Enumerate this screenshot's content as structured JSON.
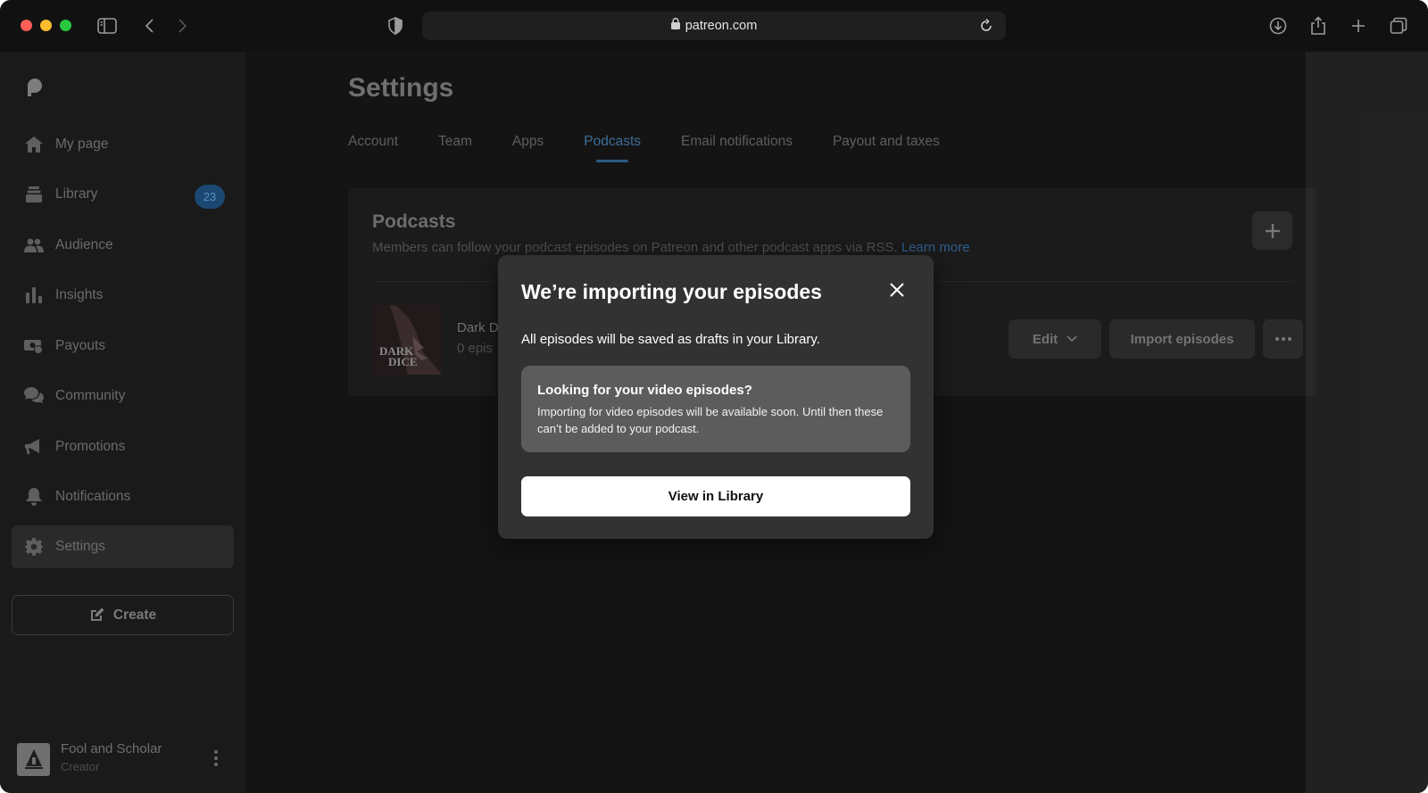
{
  "browser": {
    "url": "patreon.com"
  },
  "sidebar": {
    "items": [
      {
        "label": "My page",
        "icon": "home-icon"
      },
      {
        "label": "Library",
        "icon": "library-icon",
        "badge": "23"
      },
      {
        "label": "Audience",
        "icon": "audience-icon"
      },
      {
        "label": "Insights",
        "icon": "insights-icon"
      },
      {
        "label": "Payouts",
        "icon": "payouts-icon"
      },
      {
        "label": "Community",
        "icon": "community-icon"
      },
      {
        "label": "Promotions",
        "icon": "megaphone-icon"
      },
      {
        "label": "Notifications",
        "icon": "bell-icon"
      },
      {
        "label": "Settings",
        "icon": "gear-icon",
        "active": true
      }
    ],
    "create_label": "Create",
    "profile": {
      "name": "Fool and Scholar",
      "role": "Creator"
    }
  },
  "page": {
    "title": "Settings",
    "tabs": [
      {
        "label": "Account"
      },
      {
        "label": "Team"
      },
      {
        "label": "Apps"
      },
      {
        "label": "Podcasts",
        "active": true
      },
      {
        "label": "Email notifications"
      },
      {
        "label": "Payout and taxes"
      }
    ]
  },
  "podcasts_card": {
    "title": "Podcasts",
    "description": "Members can follow your podcast episodes on Patreon and other podcast apps via RSS.",
    "learn_more": "Learn more",
    "podcast": {
      "art_text_line1": "DARK",
      "art_text_line2": "DICE",
      "name": "Dark D",
      "episodes": "0 epis"
    },
    "edit_label": "Edit",
    "import_label": "Import episodes"
  },
  "modal": {
    "title": "We’re importing your episodes",
    "text": "All episodes will be saved as drafts in your Library.",
    "info_title": "Looking for your video episodes?",
    "info_text": "Importing for video episodes will be available soon. Until then these can’t be added to your podcast.",
    "button_label": "View in Library"
  },
  "colors": {
    "accent": "#3e6d97",
    "badge": "#1b4872",
    "modal_bg": "#323232",
    "info_box": "#5c5c5c"
  }
}
